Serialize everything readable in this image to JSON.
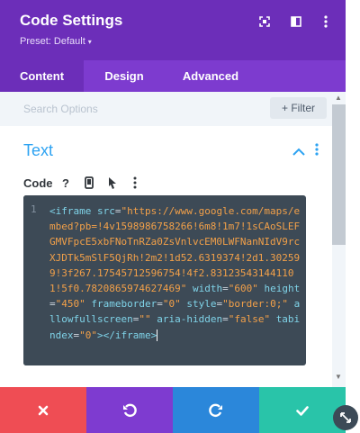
{
  "header": {
    "title": "Code Settings",
    "preset_label": "Preset: Default",
    "preset_caret": "▾",
    "icons": [
      "fullscreen-icon",
      "sidebar-icon",
      "more-icon"
    ]
  },
  "tabs": [
    {
      "label": "Content",
      "active": true
    },
    {
      "label": "Design",
      "active": false
    },
    {
      "label": "Advanced",
      "active": false
    }
  ],
  "search": {
    "placeholder": "Search Options",
    "filter_label": "+ Filter"
  },
  "section": {
    "title": "Text",
    "field_label": "Code",
    "field_icons": [
      "help-icon",
      "mobile-icon",
      "pointer-icon",
      "more-icon"
    ]
  },
  "editor": {
    "line_number": "1",
    "code": "<iframe src=\"https://www.google.com/maps/embed?pb=!4v1598986758266!6m8!1m7!1sCAoSLEFGMVFpcE5xbFNoTnRZa0ZsVnlvcEM0LWFNanNIdV9rcXJDTk5mSlF5QjRh!2m2!1d52.6319374!2d1.302599!3f267.17545712596754!4f2.831235431441101!5f0.7820865974627469\" width=\"600\" height=\"450\" frameborder=\"0\" style=\"border:0;\" allowfullscreen=\"\" aria-hidden=\"false\" tabindex=\"0\"></iframe>"
  },
  "footer": {
    "buttons": [
      {
        "name": "cancel",
        "color": "#ef4d54"
      },
      {
        "name": "undo",
        "color": "#7e3bd0"
      },
      {
        "name": "redo",
        "color": "#2b87da"
      },
      {
        "name": "save",
        "color": "#29c4a9"
      }
    ]
  },
  "colors": {
    "header": "#6c2eb9",
    "tabs": "#7d3bcf",
    "accent_blue": "#2ea3f2",
    "editor_bg": "#3d4a56"
  }
}
